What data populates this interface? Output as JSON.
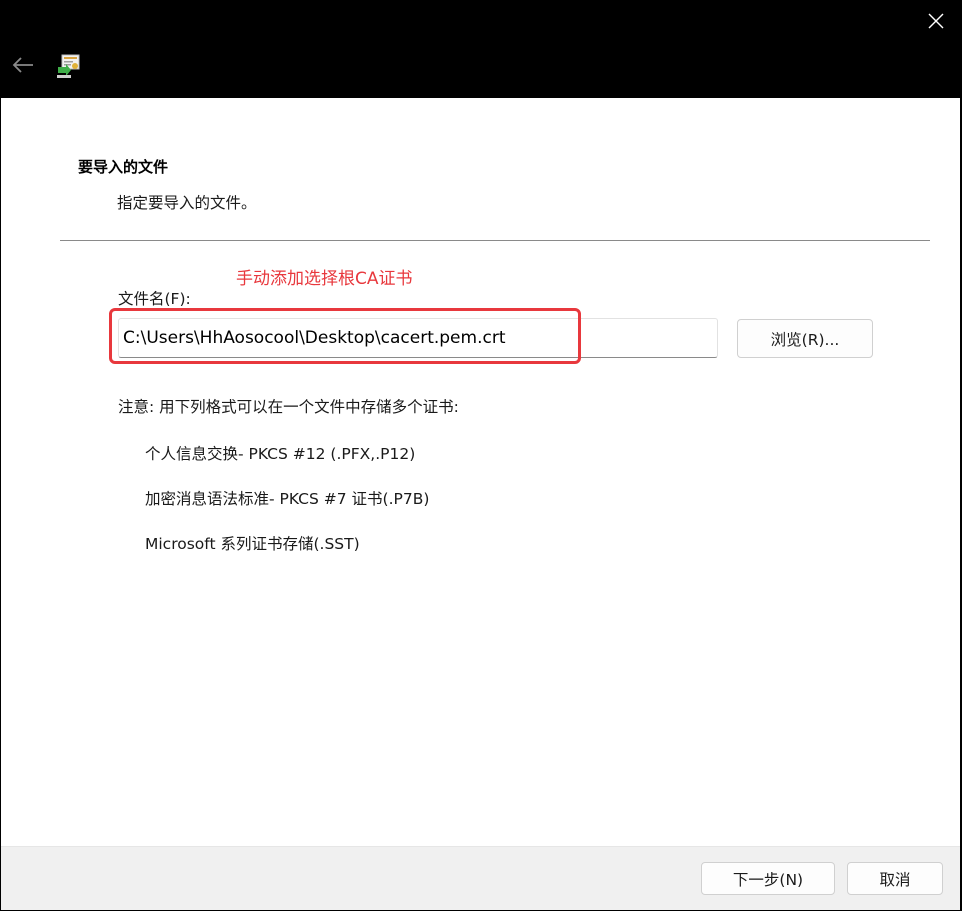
{
  "titlebar": {
    "close_glyph": "✕",
    "back_glyph": "←"
  },
  "header": {
    "title": "要导入的文件",
    "subtitle": "指定要导入的文件。"
  },
  "annotation": {
    "text": "手动添加选择根CA证书",
    "color": "#e8383d"
  },
  "file": {
    "label": "文件名(F):",
    "value": "C:\\Users\\HhAosocool\\Desktop\\cacert.pem.crt",
    "browse_label": "浏览(R)..."
  },
  "note": {
    "text": "注意: 用下列格式可以在一个文件中存储多个证书:",
    "formats": [
      "个人信息交换- PKCS #12 (.PFX,.P12)",
      "加密消息语法标准- PKCS #7 证书(.P7B)",
      "Microsoft 系列证书存储(.SST)"
    ]
  },
  "footer": {
    "next_label": "下一步(N)",
    "cancel_label": "取消"
  },
  "icons": {
    "close": "close-icon",
    "back": "back-arrow-icon",
    "wizard": "certificate-import-wizard-icon"
  }
}
